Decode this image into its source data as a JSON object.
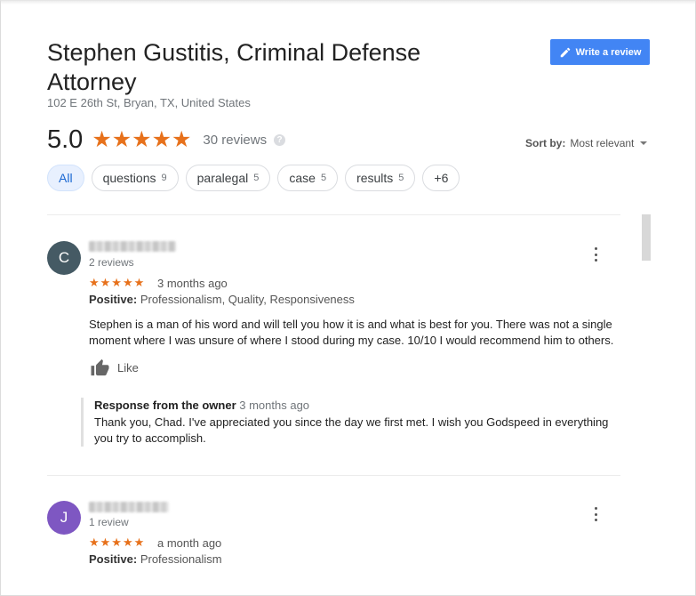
{
  "place": {
    "title": "Stephen Gustitis, Criminal Defense Attorney",
    "address": "102 E 26th St, Bryan, TX, United States"
  },
  "write_review_label": "Write a review",
  "rating": {
    "score": "5.0",
    "stars": "★★★★★",
    "count_label": "30 reviews",
    "help_glyph": "?"
  },
  "sort": {
    "label": "Sort by:",
    "value": "Most relevant"
  },
  "chips": [
    {
      "label": "All",
      "count": ""
    },
    {
      "label": "questions",
      "count": "9"
    },
    {
      "label": "paralegal",
      "count": "5"
    },
    {
      "label": "case",
      "count": "5"
    },
    {
      "label": "results",
      "count": "5"
    },
    {
      "label": "+6",
      "count": ""
    }
  ],
  "reviews": [
    {
      "initial": "C",
      "avatar_color": "#455a64",
      "reviewer_meta": "2 reviews",
      "stars": "★★★★★",
      "time": "3 months ago",
      "positive_label": "Positive:",
      "positive_value": "Professionalism, Quality, Responsiveness",
      "text": "Stephen is a man of his word and will tell you how it is and what is best for you. There was not a single moment where I was unsure of where I stood during my case. 10/10 I would recommend him to others.",
      "like_label": "Like",
      "response": {
        "title": "Response from the owner",
        "time": "3 months ago",
        "text": "Thank you, Chad. I've appreciated you since the day we first met. I wish you Godspeed in everything you try to accomplish."
      }
    },
    {
      "initial": "J",
      "avatar_color": "#7e57c2",
      "reviewer_meta": "1 review",
      "stars": "★★★★★",
      "time": "a month ago",
      "positive_label": "Positive:",
      "positive_value": "Professionalism"
    }
  ],
  "colors": {
    "accent_blue": "#4285f4",
    "star_orange": "#e7711b",
    "chip_active_bg": "#e8f0fe"
  },
  "icons": [
    "pencil-icon",
    "help-icon",
    "dropdown-caret-icon",
    "more-options-icon",
    "thumbs-up-icon"
  ]
}
